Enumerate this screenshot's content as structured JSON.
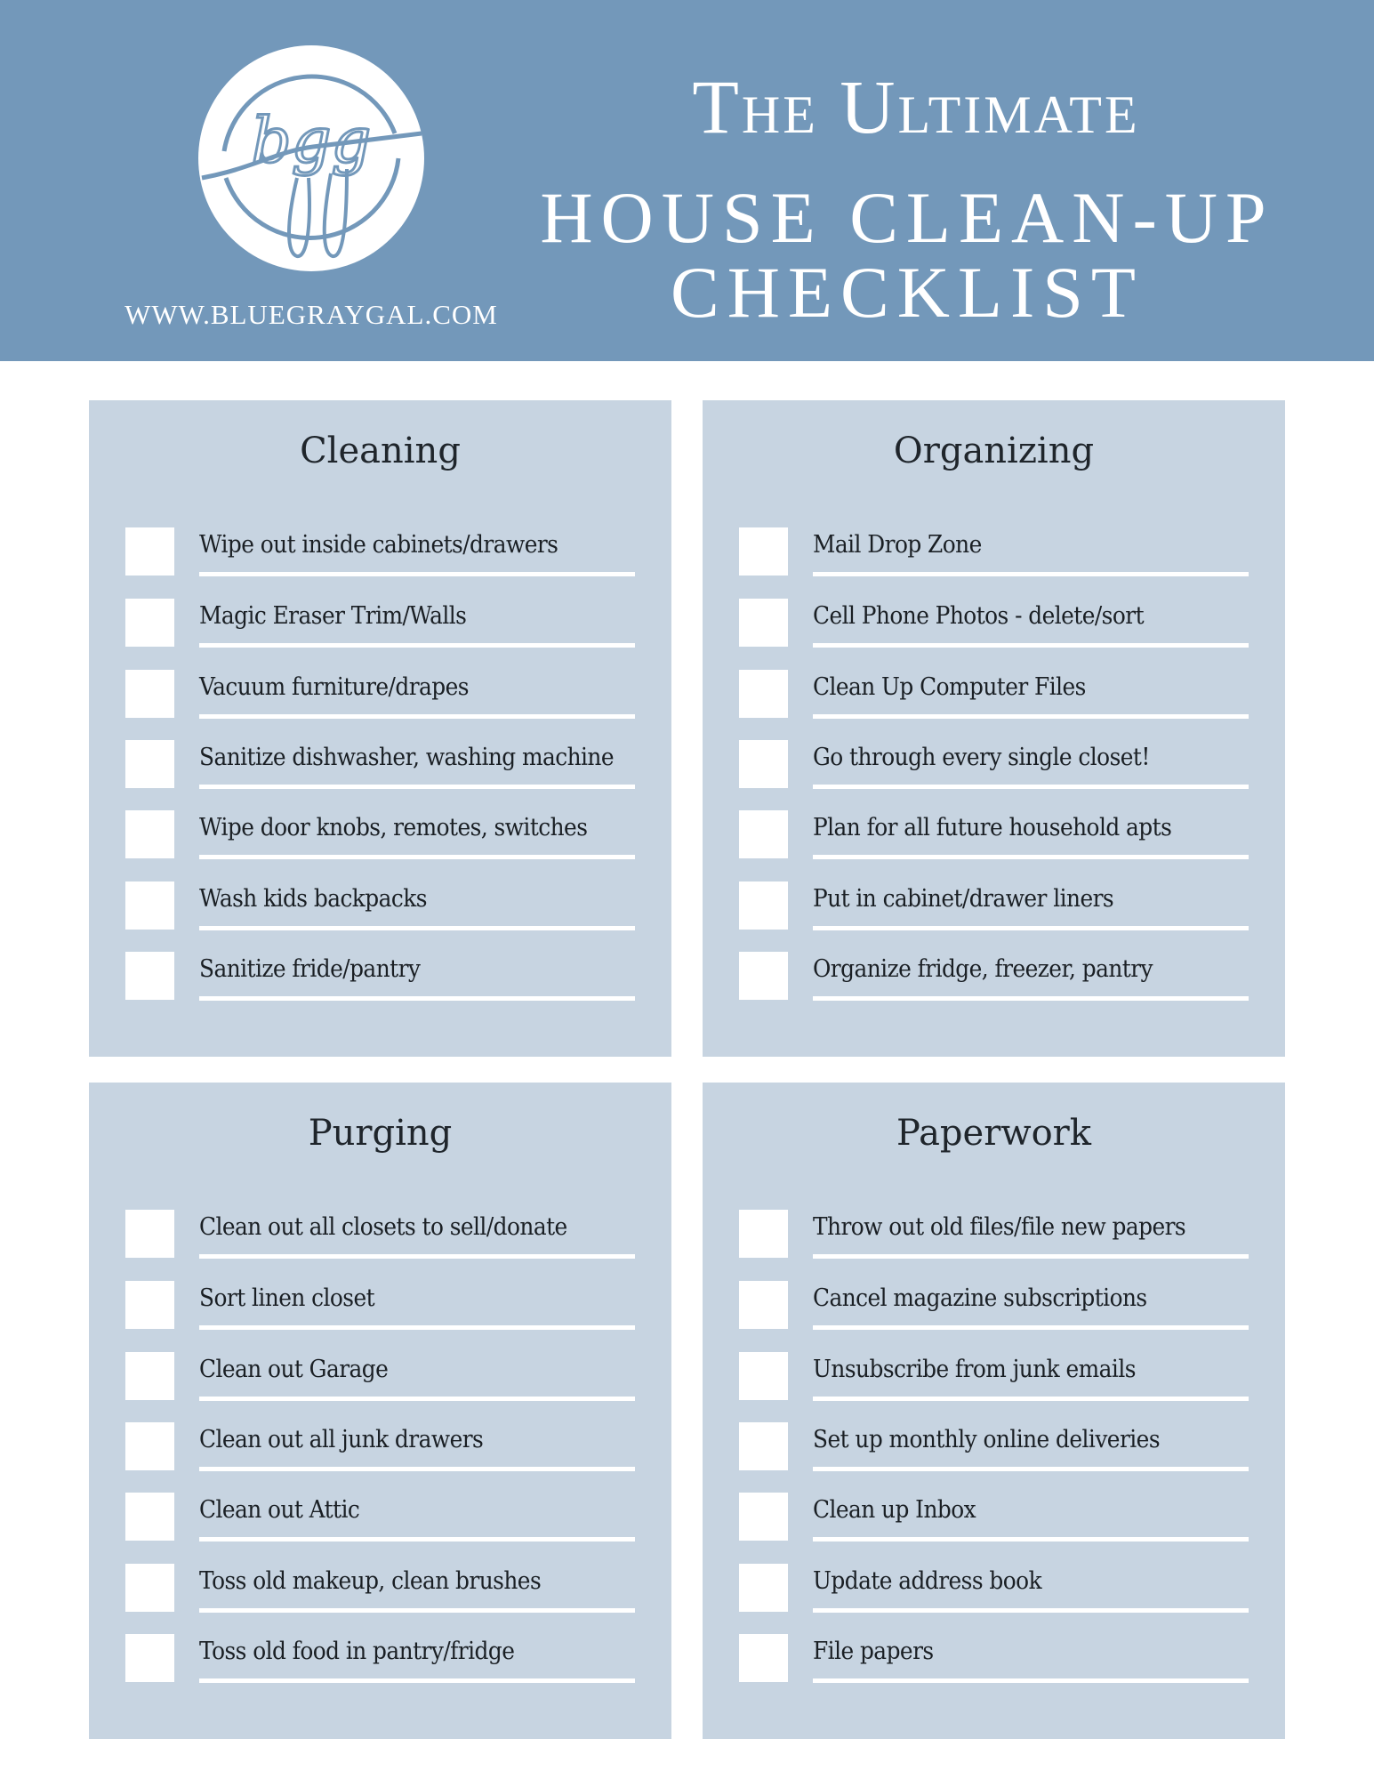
{
  "header": {
    "logo_text": "bgg",
    "site_url": "WWW.BLUEGRAYGAL.COM",
    "title_line1": "The Ultimate",
    "title_line2": "HOUSE CLEAN-UP",
    "title_line3": "CHECKLIST"
  },
  "colors": {
    "header_bg": "#7398ba",
    "panel_bg": "#c7d4e1",
    "text": "#1a1f24",
    "checkbox": "#ffffff"
  },
  "sections": [
    {
      "title": "Cleaning",
      "items": [
        {
          "label": "Wipe out inside cabinets/drawers",
          "checked": false
        },
        {
          "label": "Magic Eraser Trim/Walls",
          "checked": false
        },
        {
          "label": "Vacuum furniture/drapes",
          "checked": false
        },
        {
          "label": "Sanitize dishwasher, washing machine",
          "checked": false
        },
        {
          "label": "Wipe door knobs, remotes, switches",
          "checked": false
        },
        {
          "label": "Wash kids backpacks",
          "checked": false
        },
        {
          "label": "Sanitize fride/pantry",
          "checked": false
        }
      ]
    },
    {
      "title": "Organizing",
      "items": [
        {
          "label": "Mail Drop Zone",
          "checked": false
        },
        {
          "label": "Cell Phone Photos - delete/sort",
          "checked": false
        },
        {
          "label": "Clean Up Computer Files",
          "checked": false
        },
        {
          "label": "Go through every single closet!",
          "checked": false
        },
        {
          "label": "Plan for all future household apts",
          "checked": false
        },
        {
          "label": "Put in cabinet/drawer liners",
          "checked": false
        },
        {
          "label": "Organize fridge, freezer, pantry",
          "checked": false
        }
      ]
    },
    {
      "title": "Purging",
      "items": [
        {
          "label": "Clean out all closets to sell/donate",
          "checked": false
        },
        {
          "label": "Sort linen closet",
          "checked": false
        },
        {
          "label": "Clean out Garage",
          "checked": false
        },
        {
          "label": "Clean out all junk drawers",
          "checked": false
        },
        {
          "label": "Clean out Attic",
          "checked": false
        },
        {
          "label": "Toss old makeup, clean brushes",
          "checked": false
        },
        {
          "label": "Toss old food in pantry/fridge",
          "checked": false
        }
      ]
    },
    {
      "title": "Paperwork",
      "items": [
        {
          "label": "Throw out old files/file new papers",
          "checked": false
        },
        {
          "label": "Cancel magazine subscriptions",
          "checked": false
        },
        {
          "label": "Unsubscribe from junk emails",
          "checked": false
        },
        {
          "label": "Set up monthly online deliveries",
          "checked": false
        },
        {
          "label": "Clean up Inbox",
          "checked": false
        },
        {
          "label": "Update address book",
          "checked": false
        },
        {
          "label": "File papers",
          "checked": false
        }
      ]
    }
  ]
}
